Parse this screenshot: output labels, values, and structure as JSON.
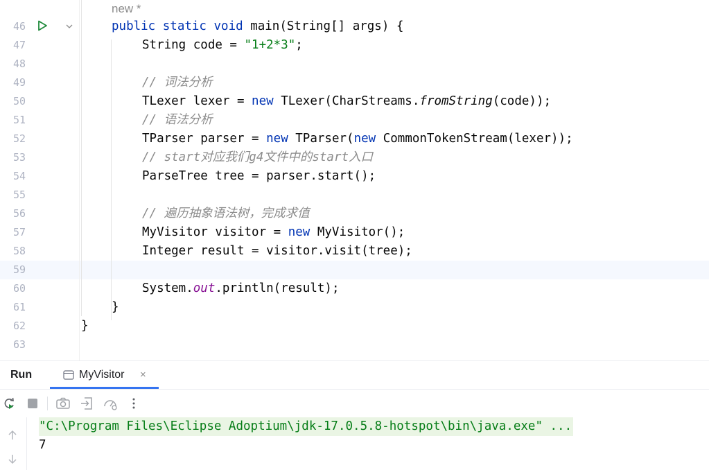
{
  "editor": {
    "hint": "new *",
    "current_line": "59",
    "lines": [
      {
        "num": "46",
        "indent": 1,
        "tokens": [
          {
            "t": "public static void ",
            "c": "kw"
          },
          {
            "t": "main(String[] args) {",
            "c": ""
          }
        ]
      },
      {
        "num": "47",
        "indent": 2,
        "tokens": [
          {
            "t": "String code = ",
            "c": ""
          },
          {
            "t": "\"1+2*3\"",
            "c": "str"
          },
          {
            "t": ";",
            "c": ""
          }
        ]
      },
      {
        "num": "48",
        "indent": 2,
        "tokens": []
      },
      {
        "num": "49",
        "indent": 2,
        "tokens": [
          {
            "t": "// 词法分析",
            "c": "cmt"
          }
        ]
      },
      {
        "num": "50",
        "indent": 2,
        "tokens": [
          {
            "t": "TLexer lexer = ",
            "c": ""
          },
          {
            "t": "new",
            "c": "kw"
          },
          {
            "t": " TLexer(CharStreams.",
            "c": ""
          },
          {
            "t": "fromString",
            "c": "ital"
          },
          {
            "t": "(code));",
            "c": ""
          }
        ]
      },
      {
        "num": "51",
        "indent": 2,
        "tokens": [
          {
            "t": "// 语法分析",
            "c": "cmt"
          }
        ]
      },
      {
        "num": "52",
        "indent": 2,
        "tokens": [
          {
            "t": "TParser parser = ",
            "c": ""
          },
          {
            "t": "new",
            "c": "kw"
          },
          {
            "t": " TParser(",
            "c": ""
          },
          {
            "t": "new",
            "c": "kw"
          },
          {
            "t": " CommonTokenStream(lexer));",
            "c": ""
          }
        ]
      },
      {
        "num": "53",
        "indent": 2,
        "tokens": [
          {
            "t": "// start对应我们g4文件中的start入口",
            "c": "cmt"
          }
        ]
      },
      {
        "num": "54",
        "indent": 2,
        "tokens": [
          {
            "t": "ParseTree tree = parser.start();",
            "c": ""
          }
        ]
      },
      {
        "num": "55",
        "indent": 2,
        "tokens": []
      },
      {
        "num": "56",
        "indent": 2,
        "tokens": [
          {
            "t": "// 遍历抽象语法树，完成求值",
            "c": "cmt"
          }
        ]
      },
      {
        "num": "57",
        "indent": 2,
        "tokens": [
          {
            "t": "MyVisitor visitor = ",
            "c": ""
          },
          {
            "t": "new",
            "c": "kw"
          },
          {
            "t": " MyVisitor();",
            "c": ""
          }
        ]
      },
      {
        "num": "58",
        "indent": 2,
        "tokens": [
          {
            "t": "Integer result = visitor.visit(tree);",
            "c": ""
          }
        ]
      },
      {
        "num": "59",
        "indent": 2,
        "tokens": []
      },
      {
        "num": "60",
        "indent": 2,
        "tokens": [
          {
            "t": "System.",
            "c": ""
          },
          {
            "t": "out",
            "c": "stat"
          },
          {
            "t": ".println(result);",
            "c": ""
          }
        ]
      },
      {
        "num": "61",
        "indent": 1,
        "tokens": [
          {
            "t": "}",
            "c": ""
          }
        ]
      },
      {
        "num": "62",
        "indent": 0,
        "tokens": [
          {
            "t": "}",
            "c": ""
          }
        ]
      },
      {
        "num": "63",
        "indent": 0,
        "tokens": []
      }
    ]
  },
  "run_panel": {
    "title": "Run",
    "tab": {
      "label": "MyVisitor",
      "close": "×"
    },
    "toolbar": [
      "rerun-icon",
      "stop-icon",
      "screenshot-icon",
      "export-icon",
      "profiler-icon",
      "more-icon"
    ],
    "console": {
      "command": "\"C:\\Program Files\\Eclipse Adoptium\\jdk-17.0.5.8-hotspot\\bin\\java.exe\" ...",
      "output": "7"
    }
  },
  "colors": {
    "keyword": "#0033b3",
    "string": "#067d17",
    "comment": "#8c8c8c",
    "static_field": "#871094",
    "current_line_bg": "#f5f8fe",
    "command_bg": "#eaf5e4",
    "tab_accent": "#3574f0"
  }
}
